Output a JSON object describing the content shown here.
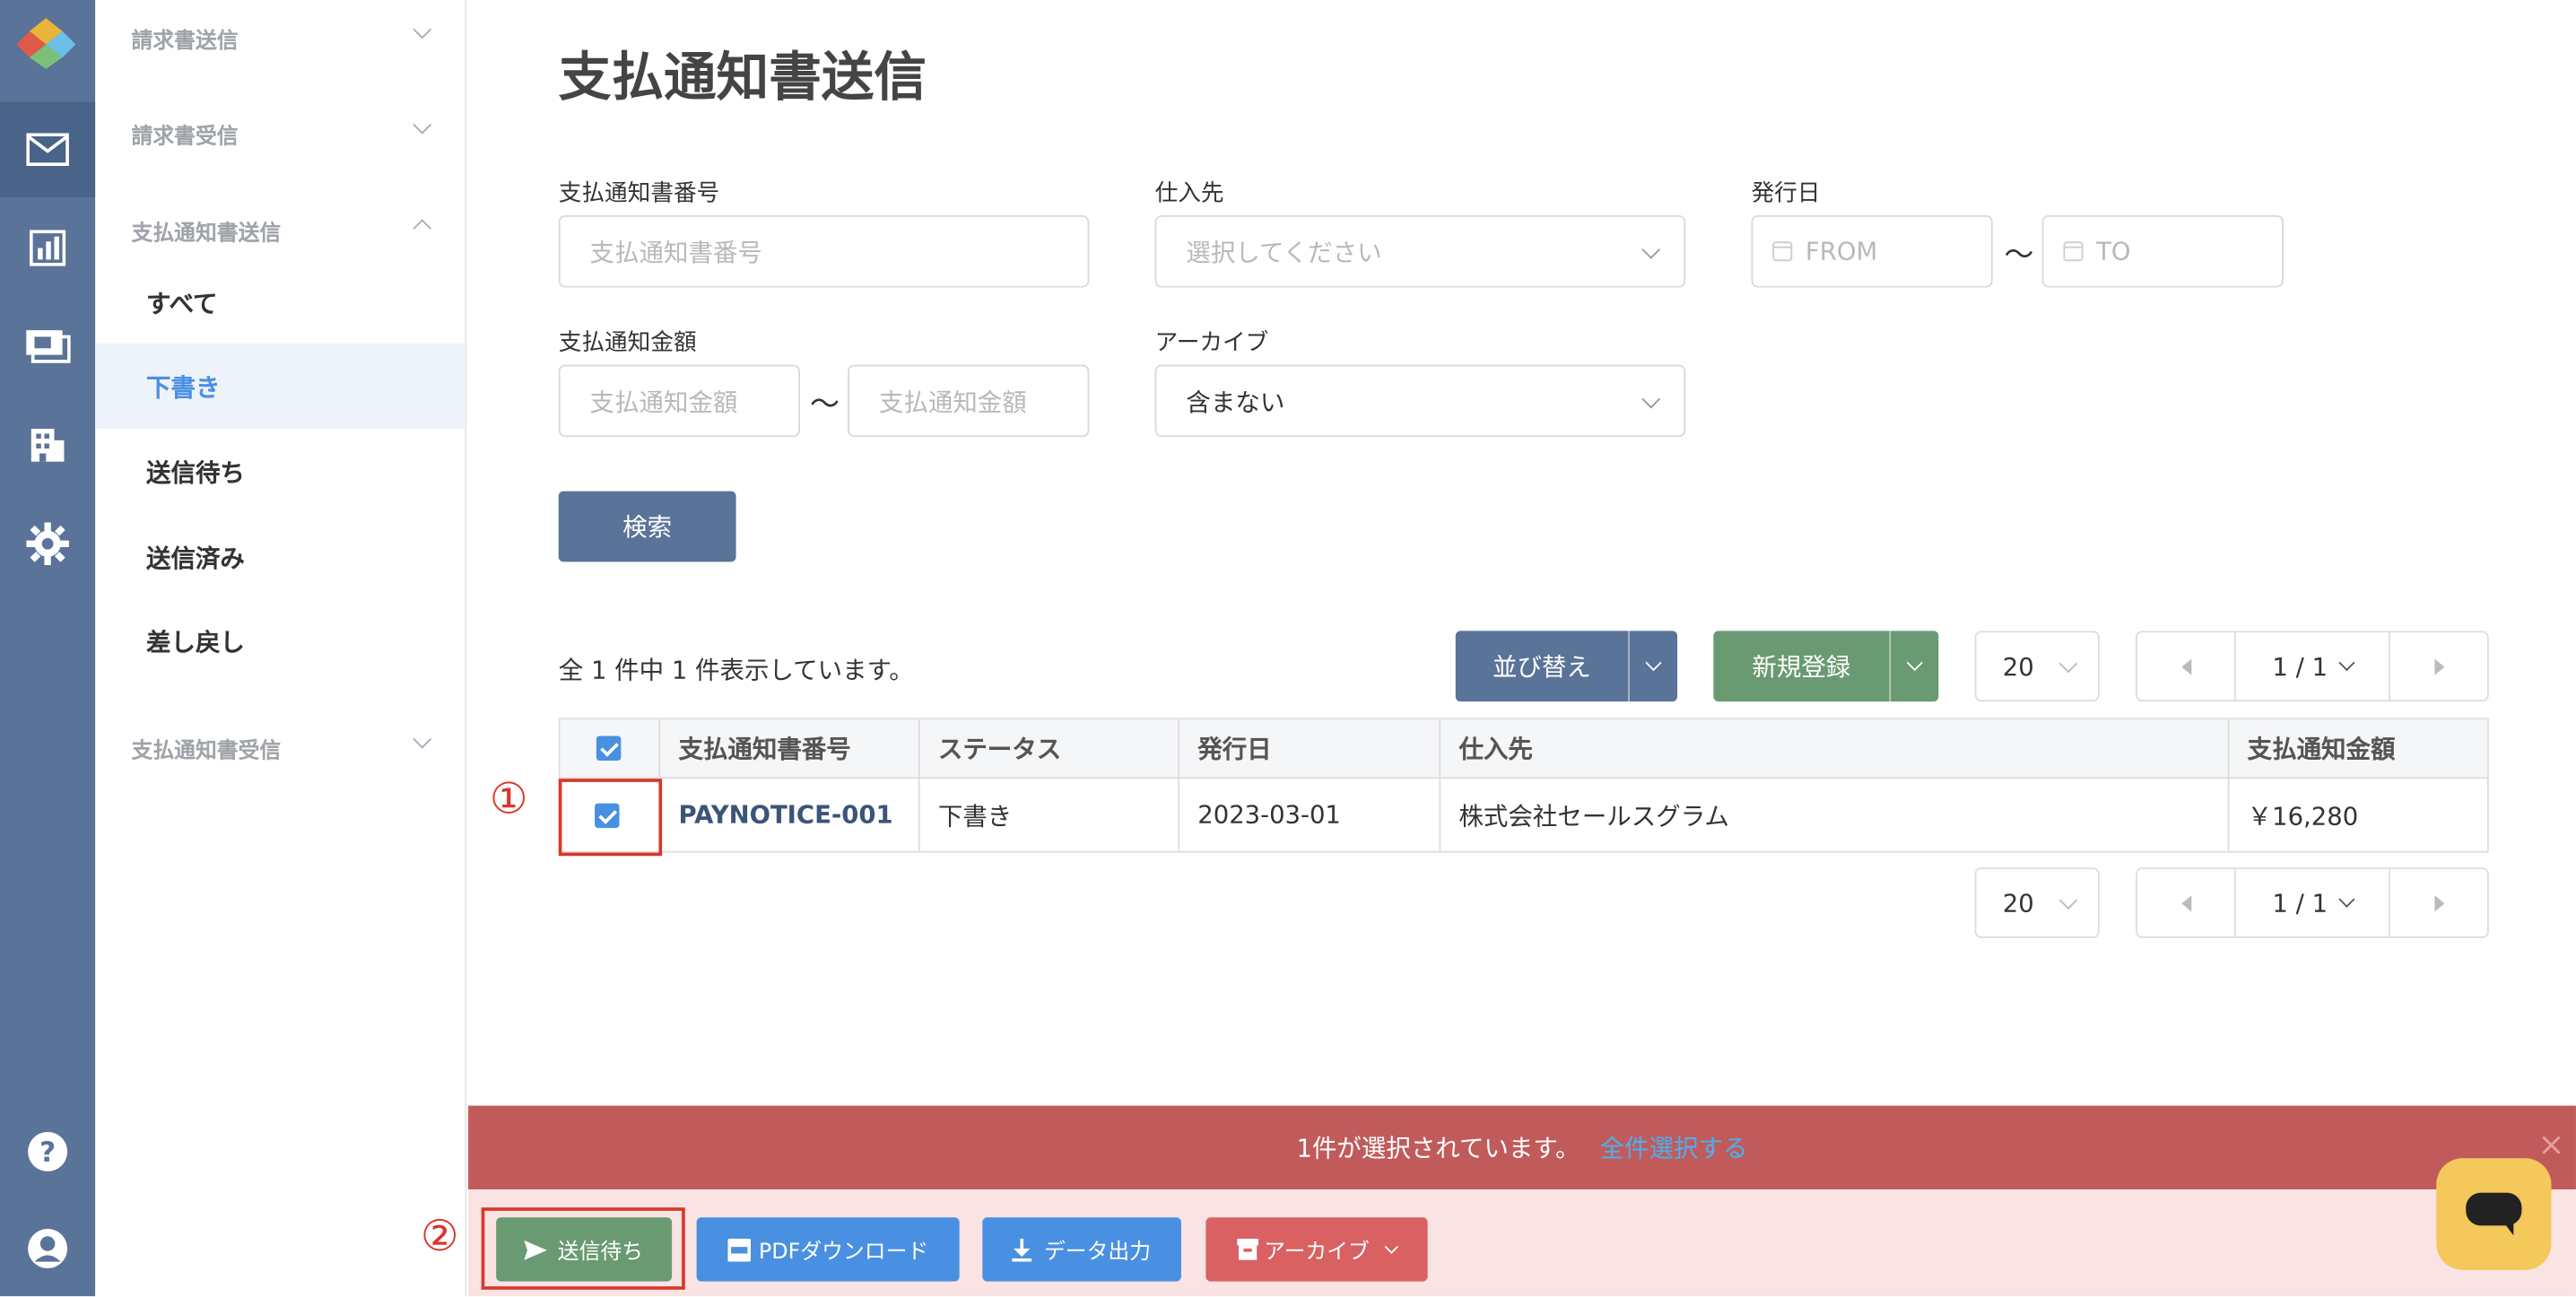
{
  "sidebar": {
    "sections": [
      {
        "label": "請求書送信"
      },
      {
        "label": "請求書受信"
      },
      {
        "label": "支払通知書送信"
      },
      {
        "label": "支払通知書受信"
      }
    ],
    "items": [
      {
        "label": "すべて"
      },
      {
        "label": "下書き"
      },
      {
        "label": "送信待ち"
      },
      {
        "label": "送信済み"
      },
      {
        "label": "差し戻し"
      }
    ]
  },
  "page": {
    "title": "支払通知書送信"
  },
  "filters": {
    "number_label": "支払通知書番号",
    "number_placeholder": "支払通知書番号",
    "supplier_label": "仕入先",
    "supplier_placeholder": "選択してください",
    "issue_date_label": "発行日",
    "date_from_placeholder": "FROM",
    "date_to_placeholder": "TO",
    "amount_label": "支払通知金額",
    "amount_min_placeholder": "支払通知金額",
    "amount_max_placeholder": "支払通知金額",
    "archive_label": "アーカイブ",
    "archive_value": "含まない",
    "range_sep": "〜",
    "search_button": "検索"
  },
  "results": {
    "summary": "全 1 件中 1 件表示しています。",
    "sort_button": "並び替え",
    "new_button": "新規登録",
    "per_page": "20",
    "page_indicator": "1 / 1"
  },
  "table": {
    "columns": [
      "支払通知書番号",
      "ステータス",
      "発行日",
      "仕入先",
      "支払通知金額"
    ],
    "rows": [
      {
        "number": "PAYNOTICE-001",
        "status": "下書き",
        "issue_date": "2023-03-01",
        "supplier": "株式会社セールスグラム",
        "amount": "￥16,280"
      }
    ]
  },
  "annotations": {
    "step1": "①",
    "step2": "②"
  },
  "selection_bar": {
    "text": "1件が選択されています。",
    "select_all": "全件選択する"
  },
  "actions": {
    "send_wait": "送信待ち",
    "pdf_download": "PDFダウンロード",
    "data_export": "データ出力",
    "archive": "アーカイブ"
  },
  "colors": {
    "rail": "#5a7398",
    "accent_blue": "#4a90e2",
    "green": "#6a9a72",
    "red_bar": "#c15b5b",
    "annotation_red": "#d9372b"
  }
}
